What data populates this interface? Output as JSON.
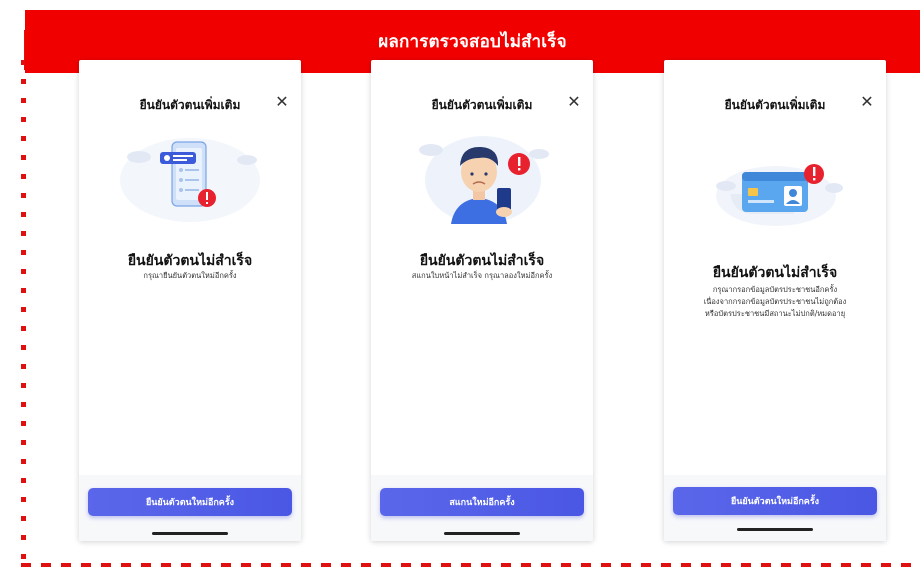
{
  "banner": {
    "text": "ผลการตรวจสอบไม่สำเร็จ"
  },
  "colors": {
    "banner": "#f10000",
    "frame": "#e01010",
    "cta": "#5561e8",
    "alert": "#e8212e"
  },
  "screens": [
    {
      "title": "ยืนยันตัวตนเพิ่มเติม",
      "illustration": "phone-with-alert-icon",
      "result_title": "ยืนยันตัวตนไม่สำเร็จ",
      "result_sub": "กรุณายืนยันตัวตนใหม่อีกครั้ง",
      "cta": "ยืนยันตัวตนใหม่อีกครั้ง"
    },
    {
      "title": "ยืนยันตัวตนเพิ่มเติม",
      "illustration": "man-holding-phone-icon",
      "result_title": "ยืนยันตัวตนไม่สำเร็จ",
      "result_sub": "สแกนใบหน้าไม่สำเร็จ กรุณาลองใหม่อีกครั้ง",
      "cta": "สแกนใหม่อีกครั้ง"
    },
    {
      "title": "ยืนยันตัวตนเพิ่มเติม",
      "illustration": "id-card-alert-icon",
      "result_title": "ยืนยันตัวตนไม่สำเร็จ",
      "result_sub_lines": [
        "กรุณากรอกข้อมูลบัตรประชาชนอีกครั้ง",
        "เนื่องจากกรอกข้อมูลบัตรประชาชนไม่ถูกต้อง",
        "หรือบัตรประชาชนมีสถานะไม่ปกติ/หมดอายุ"
      ],
      "cta": "ยืนยันตัวตนใหม่อีกครั้ง"
    }
  ]
}
